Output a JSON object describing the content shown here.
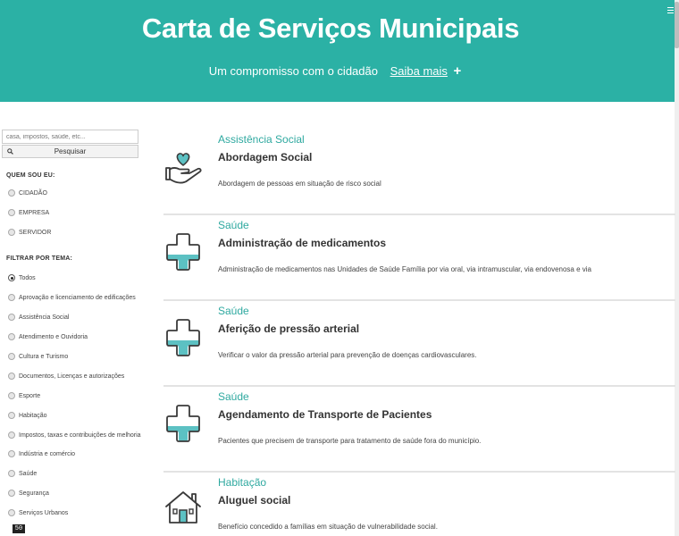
{
  "header": {
    "title": "Carta de Serviços Municipais",
    "subtitle": "Um compromisso com o cidadão",
    "more_link": "Saiba mais",
    "more_icon": "+"
  },
  "sidebar": {
    "search": {
      "placeholder": "casa, impostos, saúde, etc...",
      "value": "",
      "button_label": "Pesquisar"
    },
    "who_title": "QUEM SOU EU:",
    "who_options": [
      "CIDADÃO",
      "EMPRESA",
      "SERVIDOR"
    ],
    "filter_title": "FILTRAR POR TEMA:",
    "filter_options": [
      "Todos",
      "Aprovação e licenciamento de edificações",
      "Assistência Social",
      "Atendimento e Ouvidoria",
      "Cultura e Turismo",
      "Documentos, Licenças e autorizações",
      "Esporte",
      "Habitação",
      "Impostos, taxas e contribuições de melhoria",
      "Indústria e comércio",
      "Saúde",
      "Segurança",
      "Serviços Urbanos"
    ],
    "filter_selected": "Todos",
    "counter": "50"
  },
  "services": [
    {
      "category": "Assistência Social",
      "title": "Abordagem Social",
      "description": "Abordagem de pessoas em situação de risco social",
      "icon": "hand-heart-icon"
    },
    {
      "category": "Saúde",
      "title": "Administração de medicamentos",
      "description": "Administração de medicamentos nas Unidades de Saúde Família por via oral, via intramuscular, via endovenosa e via",
      "icon": "health-cross-icon"
    },
    {
      "category": "Saúde",
      "title": "Aferição de pressão arterial",
      "description": "Verificar o valor da pressão arterial para prevenção de doenças cardiovasculares.",
      "icon": "health-cross-icon"
    },
    {
      "category": "Saúde",
      "title": "Agendamento de Transporte de Pacientes",
      "description": "Pacientes que precisem de transporte para tratamento de saúde fora do município.",
      "icon": "health-cross-icon"
    },
    {
      "category": "Habitação",
      "title": "Aluguel social",
      "description": "Benefício concedido a famílias em situação de vulnerabilidade social.",
      "icon": "house-icon"
    }
  ],
  "colors": {
    "brand": "#2bb1a5",
    "accent_text": "#2fa9a0",
    "icon_fill": "#5cc1c3",
    "icon_stroke": "#3a3a3a"
  }
}
